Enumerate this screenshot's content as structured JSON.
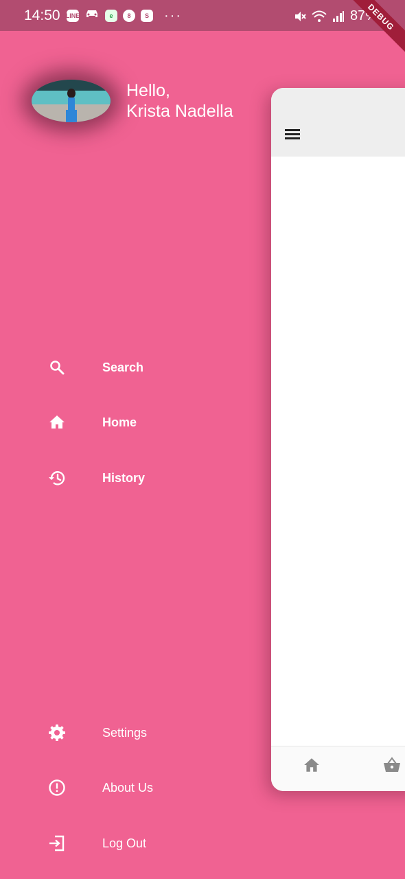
{
  "status_bar": {
    "time": "14:50",
    "battery": "87%",
    "left_icons": [
      "line-icon",
      "car-icon",
      "evernote-icon",
      "b-circle-icon",
      "shopee-icon"
    ],
    "right_icons": [
      "mute-icon",
      "wifi-icon",
      "signal-icon"
    ]
  },
  "debug_banner": "DEBUG",
  "profile": {
    "greeting": "Hello,",
    "name": "Krista Nadella"
  },
  "menu": {
    "primary": [
      {
        "label": "Search",
        "icon": "search-icon"
      },
      {
        "label": "Home",
        "icon": "home-icon"
      },
      {
        "label": "History",
        "icon": "history-icon"
      }
    ],
    "secondary": [
      {
        "label": "Settings",
        "icon": "gear-icon"
      },
      {
        "label": "About Us",
        "icon": "info-icon"
      },
      {
        "label": "Log Out",
        "icon": "logout-icon"
      }
    ]
  },
  "main_panel": {
    "bottom_nav": [
      "home-icon",
      "basket-icon"
    ]
  },
  "colors": {
    "drawer_background": "#f06292",
    "status_bar": "#b24c70",
    "panel_appbar": "#eeeeee",
    "nav_icon": "#8a8a8a"
  }
}
